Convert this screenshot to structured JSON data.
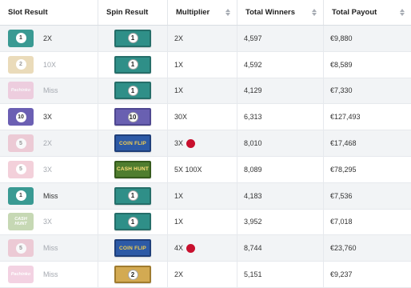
{
  "header": {
    "slot_result": "Slot Result",
    "spin_result": "Spin Result",
    "multiplier": "Multiplier",
    "total_winners": "Total Winners",
    "total_payout": "Total Payout"
  },
  "colors": {
    "live_dot": "#c8102e",
    "row_alt_bg": "#f2f4f6",
    "muted_text": "#a5a9b0"
  },
  "rows": [
    {
      "slot_icon": "1-icon",
      "slot_text": "1",
      "slot_label": "2X",
      "muted": false,
      "spin_icon": "bill-1",
      "spin_text": "1",
      "multiplier": "2X",
      "live": false,
      "winners": "4,597",
      "payout": "€9,880"
    },
    {
      "slot_icon": "2-icon",
      "slot_text": "2",
      "slot_label": "10X",
      "muted": true,
      "spin_icon": "bill-1",
      "spin_text": "1",
      "multiplier": "1X",
      "live": false,
      "winners": "4,592",
      "payout": "€8,589"
    },
    {
      "slot_icon": "pachinko-icon",
      "slot_text": "Pachinko",
      "slot_label": "Miss",
      "muted": true,
      "spin_icon": "bill-1",
      "spin_text": "1",
      "multiplier": "1X",
      "live": false,
      "winners": "4,129",
      "payout": "€7,330"
    },
    {
      "slot_icon": "10-icon",
      "slot_text": "10",
      "slot_label": "3X",
      "muted": false,
      "spin_icon": "bill-10",
      "spin_text": "10",
      "multiplier": "30X",
      "live": false,
      "winners": "6,313",
      "payout": "€127,493"
    },
    {
      "slot_icon": "5-icon",
      "slot_text": "5",
      "slot_label": "2X",
      "muted": true,
      "spin_icon": "bill-coinflip",
      "spin_text": "COIN FLIP",
      "multiplier": "3X",
      "live": true,
      "winners": "8,010",
      "payout": "€17,468"
    },
    {
      "slot_icon": "5-icon",
      "slot_text": "5",
      "slot_label": "3X",
      "muted": true,
      "spin_icon": "bill-cashhunt",
      "spin_text": "CASH HUNT",
      "multiplier": "5X 100X",
      "live": false,
      "winners": "8,089",
      "payout": "€78,295"
    },
    {
      "slot_icon": "1-icon",
      "slot_text": "1",
      "slot_label": "Miss",
      "muted": false,
      "spin_icon": "bill-1",
      "spin_text": "1",
      "multiplier": "1X",
      "live": false,
      "winners": "4,183",
      "payout": "€7,536"
    },
    {
      "slot_icon": "cashhunt-icon",
      "slot_text": "CASH HUNT",
      "slot_label": "3X",
      "muted": true,
      "spin_icon": "bill-1",
      "spin_text": "1",
      "multiplier": "1X",
      "live": false,
      "winners": "3,952",
      "payout": "€7,018"
    },
    {
      "slot_icon": "5-icon",
      "slot_text": "5",
      "slot_label": "Miss",
      "muted": true,
      "spin_icon": "bill-coinflip",
      "spin_text": "COIN FLIP",
      "multiplier": "4X",
      "live": true,
      "winners": "8,744",
      "payout": "€23,760"
    },
    {
      "slot_icon": "pachinko-icon",
      "slot_text": "Pachinko",
      "slot_label": "Miss",
      "muted": true,
      "spin_icon": "bill-2",
      "spin_text": "2",
      "multiplier": "2X",
      "live": false,
      "winners": "5,151",
      "payout": "€9,237"
    }
  ]
}
